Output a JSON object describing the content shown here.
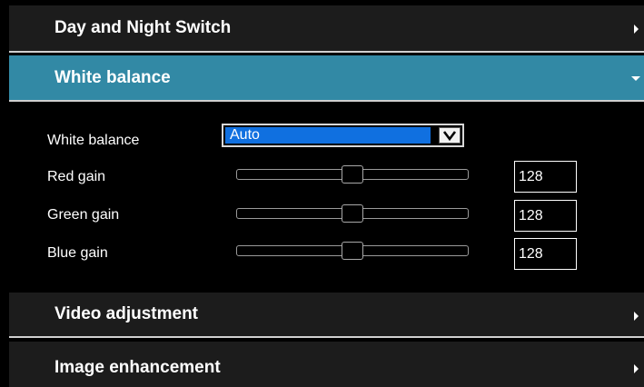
{
  "sections": {
    "day_night": {
      "title": "Day and Night Switch",
      "state": "collapsed"
    },
    "white_balance": {
      "title": "White balance",
      "state": "expanded"
    },
    "video_adjustment": {
      "title": "Video adjustment",
      "state": "collapsed"
    },
    "image_enhancement": {
      "title": "Image enhancement",
      "state": "collapsed"
    }
  },
  "white_balance_panel": {
    "mode_label": "White balance",
    "mode_value": "Auto",
    "red": {
      "label": "Red gain",
      "value": "128",
      "level": 0.5
    },
    "green": {
      "label": "Green gain",
      "value": "128",
      "level": 0.5
    },
    "blue": {
      "label": "Blue gain",
      "value": "128",
      "level": 0.5
    }
  },
  "icons": {
    "collapsed": "chevron-right-icon",
    "expanded": "chevron-down-icon",
    "select": "checkbox-down-arrow-icon"
  },
  "colors": {
    "active_header": "#3289a5",
    "header": "#1c1c1c",
    "select_highlight": "#1070e0",
    "background": "#000000"
  }
}
